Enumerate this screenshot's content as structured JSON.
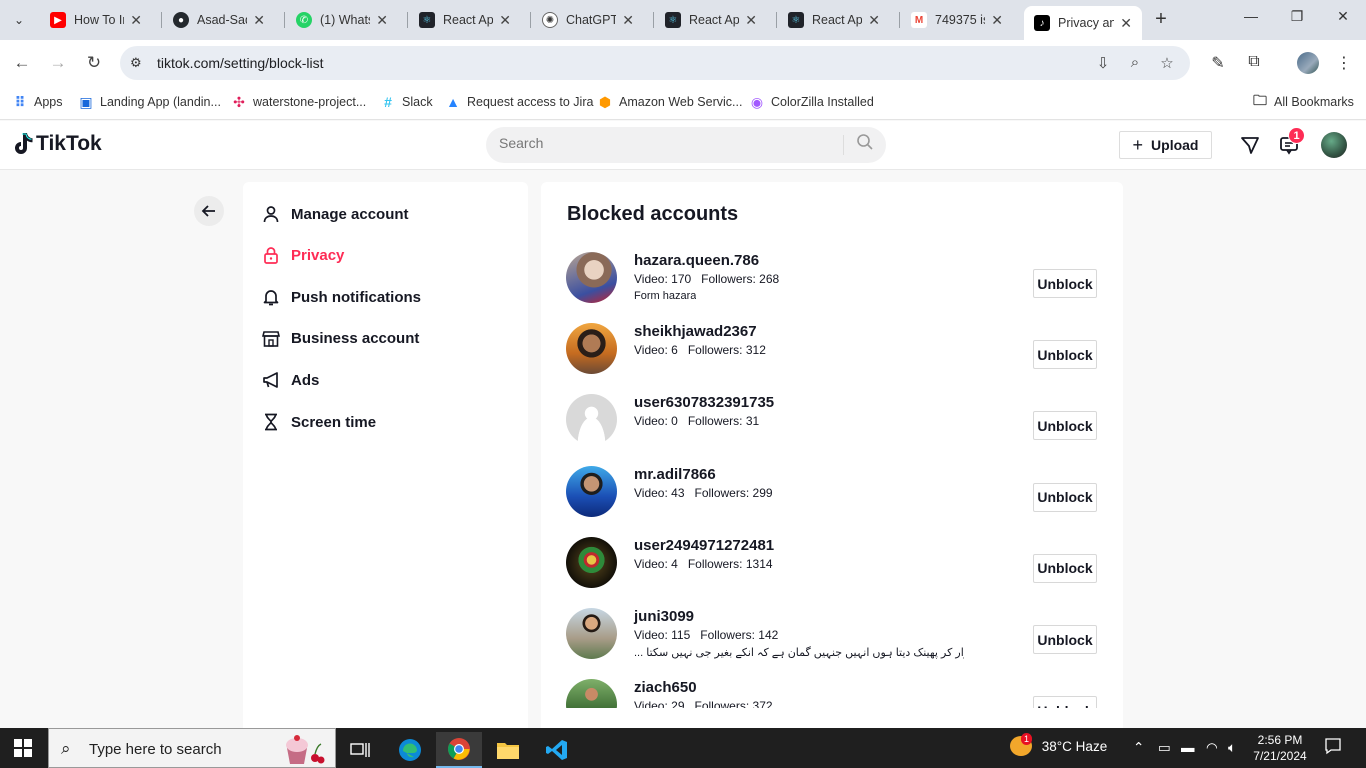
{
  "browser": {
    "tabs": [
      {
        "label": "How To In",
        "fav": "youtube-icon",
        "color": "#ff0000"
      },
      {
        "label": "Asad-Sad",
        "fav": "github-icon",
        "color": "#24292e"
      },
      {
        "label": "(1) Whats",
        "fav": "whatsapp-icon",
        "color": "#25d366"
      },
      {
        "label": "React App",
        "fav": "react-icon",
        "color": "#20232a"
      },
      {
        "label": "ChatGPT",
        "fav": "chatgpt-icon",
        "color": "#ffffff"
      },
      {
        "label": "React App",
        "fav": "react-icon",
        "color": "#20232a"
      },
      {
        "label": "React App",
        "fav": "react-icon",
        "color": "#20232a"
      },
      {
        "label": "749375 is",
        "fav": "gmail-icon",
        "color": "#ffffff"
      },
      {
        "label": "Privacy an",
        "fav": "tiktok-icon",
        "color": "#000000"
      }
    ],
    "url": "tiktok.com/setting/block-list",
    "bookmarks": [
      {
        "label": "Apps",
        "color": "#4285f4"
      },
      {
        "label": "Landing App (landin...",
        "color": "#1868db"
      },
      {
        "label": "waterstone-project...",
        "color": "#e01e5a"
      },
      {
        "label": "Slack",
        "color": "#36c5f0"
      },
      {
        "label": "Request access to Jira",
        "color": "#2684ff"
      },
      {
        "label": "Amazon Web Servic...",
        "color": "#f90"
      },
      {
        "label": "ColorZilla Installed",
        "color": "#a259ff"
      }
    ],
    "all_bookmarks": "All Bookmarks"
  },
  "tiktok": {
    "brand": "TikTok",
    "search_placeholder": "Search",
    "upload_label": "Upload",
    "inbox_badge": "1",
    "accent": "#fe2c55"
  },
  "sidebar": {
    "items": [
      {
        "label": "Manage account",
        "icon": "person-icon"
      },
      {
        "label": "Privacy",
        "icon": "lock-icon",
        "active": true
      },
      {
        "label": "Push notifications",
        "icon": "bell-icon"
      },
      {
        "label": "Business account",
        "icon": "store-icon"
      },
      {
        "label": "Ads",
        "icon": "megaphone-icon"
      },
      {
        "label": "Screen time",
        "icon": "hourglass-icon"
      }
    ]
  },
  "blocked": {
    "title": "Blocked accounts",
    "button_label": "Unblock",
    "accounts": [
      {
        "username": "hazara.queen.786",
        "video": "Video: 170",
        "followers": "Followers: 268",
        "bio": "Form hazara"
      },
      {
        "username": "sheikhjawad2367",
        "video": "Video: 6",
        "followers": "Followers: 312",
        "bio": ""
      },
      {
        "username": "user6307832391735",
        "video": "Video: 0",
        "followers": "Followers: 31",
        "bio": ""
      },
      {
        "username": "mr.adil7866",
        "video": "Video: 43",
        "followers": "Followers: 299",
        "bio": ""
      },
      {
        "username": "user2494971272481",
        "video": "Video: 4",
        "followers": "Followers: 1314",
        "bio": ""
      },
      {
        "username": "juni3099",
        "video": "Video: 115",
        "followers": "Followers: 142",
        "bio": "... سر سے وار کر پھینک دیتا ہوں انہیں جنہیں گمان ہے کہ انکے بغیر جی نہیں سکتا"
      },
      {
        "username": "ziach650",
        "video": "Video: 29",
        "followers": "Followers: 372",
        "bio": ""
      }
    ]
  },
  "taskbar": {
    "search_placeholder": "Type here to search",
    "weather": "38°C  Haze",
    "weather_badge": "1",
    "time": "2:56 PM",
    "date": "7/21/2024"
  }
}
